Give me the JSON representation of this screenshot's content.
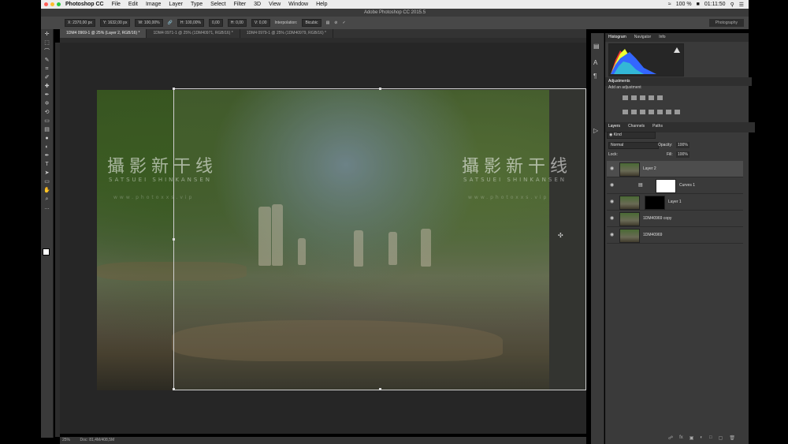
{
  "menubar": {
    "app_name": "Photoshop CC",
    "items": [
      "File",
      "Edit",
      "Image",
      "Layer",
      "Type",
      "Select",
      "Filter",
      "3D",
      "View",
      "Window",
      "Help"
    ],
    "status": "100 %",
    "flag": "■",
    "clock": "01:11:50",
    "dot_colors": [
      "#ff5f57",
      "#febc2e",
      "#28c840"
    ]
  },
  "window_title": "Adobe Photoshop CC 2015.5",
  "options": {
    "x": "X: 2370,00 px",
    "y": "Y: 1632,00 px",
    "w": "W: 100,00%",
    "h": "H: 100,00%",
    "angle": "0,00",
    "h_skew": "H: 0,00",
    "v_skew": "V: 0,00",
    "interp_label": "Interpolation:",
    "interp_value": "Bicubic",
    "workspace": "Photography"
  },
  "tabs": [
    {
      "label": "1DM4 0969-1 @ 25% (Layer 2, RGB/16) *",
      "active": true
    },
    {
      "label": "1DM4 0971-1 @ 25% (1DM40971, RGB/16) *",
      "active": false
    },
    {
      "label": "1DM4 0979-1 @ 25% (1DM40979, RGB/16) *",
      "active": false
    }
  ],
  "watermark": {
    "title": "攝影新干线",
    "subtitle": "SATSUEI SHINKANSEN",
    "url": "www.photoxxs.vip"
  },
  "status_bar": {
    "zoom": "25%",
    "doc": "Doc: 81,4M/408,5M"
  },
  "panel": {
    "top_tabs": [
      "Histogram",
      "Navigator",
      "Info"
    ],
    "adjustments_title": "Adjustments",
    "adjustments_sub": "Add an adjustment",
    "layers_tabs": [
      "Layers",
      "Channels",
      "Paths"
    ],
    "filter_label": "◉ Kind",
    "blend_mode": "Normal",
    "opacity_label": "Opacity:",
    "opacity_value": "100%",
    "lock_label": "Lock:",
    "fill_label": "Fill:",
    "fill_value": "100%",
    "layers": [
      {
        "name": "Layer 2",
        "selected": true,
        "type": "image"
      },
      {
        "name": "Curves 1",
        "selected": false,
        "type": "curves"
      },
      {
        "name": "Layer 1",
        "selected": false,
        "type": "masked"
      },
      {
        "name": "1DM40969 copy",
        "selected": false,
        "type": "image"
      },
      {
        "name": "1DM40969",
        "selected": false,
        "type": "image"
      }
    ]
  },
  "tools": [
    "move-tool",
    "marquee-tool",
    "lasso-tool",
    "quick-select-tool",
    "crop-tool",
    "eyedropper-tool",
    "healing-tool",
    "brush-tool",
    "stamp-tool",
    "history-brush-tool",
    "eraser-tool",
    "gradient-tool",
    "blur-tool",
    "dodge-tool",
    "pen-tool",
    "type-tool",
    "path-select-tool",
    "shape-tool",
    "hand-tool",
    "zoom-tool",
    "more-tools-icon"
  ],
  "tool_glyphs": [
    "✛",
    "⬚",
    "⌒",
    "✎",
    "⌗",
    "✐",
    "✚",
    "✒",
    "✡",
    "⟲",
    "▭",
    "▤",
    "●",
    "◐",
    "✒",
    "T",
    "➤",
    "▭",
    "✋",
    "⌕",
    "…"
  ]
}
